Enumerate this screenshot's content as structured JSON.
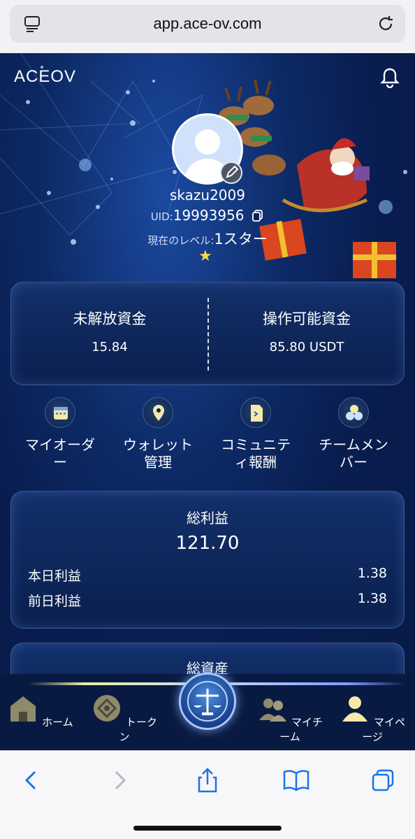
{
  "browser": {
    "url": "app.ace-ov.com"
  },
  "header": {
    "brand": "ACEOV"
  },
  "profile": {
    "username": "skazu2009",
    "uid_label": "UID:",
    "uid_value": "19993956",
    "level_label": "現在のレベル:",
    "level_value": "1スター"
  },
  "funds": {
    "locked_label": "未解放資金",
    "locked_value": "15.84",
    "available_label": "操作可能資金",
    "available_value": "85.80 USDT"
  },
  "menu": {
    "items": [
      {
        "label_l1": "マイオーダ",
        "label_l2": "ー",
        "icon": "calendar-icon"
      },
      {
        "label_l1": "ウォレット",
        "label_l2": "管理",
        "icon": "location-pin-icon"
      },
      {
        "label_l1": "コミュニテ",
        "label_l2": "ィ報酬",
        "icon": "document-icon"
      },
      {
        "label_l1": "チームメン",
        "label_l2": "バー",
        "icon": "team-circles-icon"
      }
    ]
  },
  "profit": {
    "title": "総利益",
    "total": "121.70",
    "today_label": "本日利益",
    "today_value": "1.38",
    "yesterday_label": "前日利益",
    "yesterday_value": "1.38"
  },
  "assets": {
    "title": "総資産"
  },
  "bottom_nav": {
    "home": "ホーム",
    "token": "トークン",
    "my_team": "マイチーム",
    "my_page": "マイページ"
  },
  "colors": {
    "background": "#0b2256",
    "card_border": "#8fb0ef",
    "accent_gold": "#ffd34d"
  }
}
